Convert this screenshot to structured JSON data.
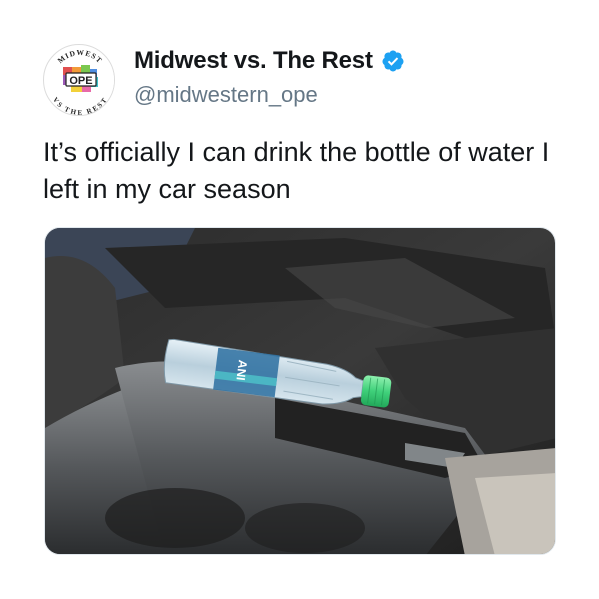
{
  "tweet": {
    "display_name": "Midwest vs. The Rest",
    "handle": "@midwestern_ope",
    "verified": true,
    "text": "It’s officially I can drink the bottle of water I left in my car season",
    "avatar": {
      "logo_text_top": "MIDWEST",
      "logo_text_center": "OPE",
      "logo_text_bottom": "VS THE REST"
    },
    "media": {
      "label_text": "ANI"
    }
  },
  "colors": {
    "verified_blue": "#1da1f2",
    "text_primary": "#14171a",
    "text_secondary": "#657786",
    "bottle_cap": "#3fd07a"
  },
  "icons": {
    "verified": "verified-badge-icon"
  }
}
